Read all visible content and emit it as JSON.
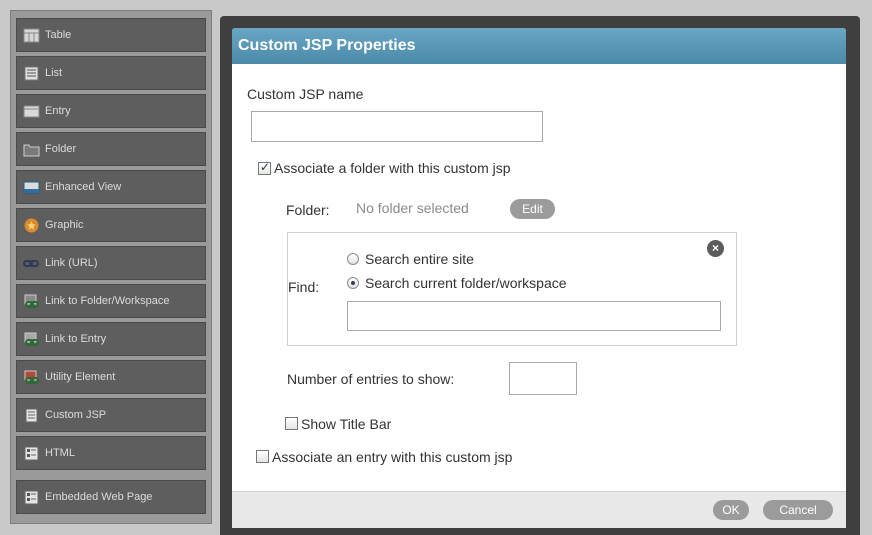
{
  "palette": {
    "items": [
      {
        "label": "Table",
        "icon": "table-icon"
      },
      {
        "label": "List",
        "icon": "list-icon"
      },
      {
        "label": "Entry",
        "icon": "entry-icon"
      },
      {
        "label": "Folder",
        "icon": "folder-icon"
      },
      {
        "label": "Enhanced View",
        "icon": "enhanced-view-icon"
      },
      {
        "label": "Graphic",
        "icon": "graphic-icon"
      },
      {
        "label": "Link (URL)",
        "icon": "link-icon"
      },
      {
        "label": "Link to Folder/Workspace",
        "icon": "link-folder-icon"
      },
      {
        "label": "Link to Entry",
        "icon": "link-entry-icon"
      },
      {
        "label": "Utility Element",
        "icon": "utility-icon"
      },
      {
        "label": "Custom JSP",
        "icon": "custom-jsp-icon"
      },
      {
        "label": "HTML",
        "icon": "html-icon"
      },
      {
        "label": "Embedded Web Page",
        "icon": "embedded-web-page-icon"
      }
    ]
  },
  "dialog": {
    "title": "Custom JSP Properties",
    "jsp_name_label": "Custom JSP name",
    "jsp_name_value": "",
    "associate_folder_label": "Associate a folder with this custom jsp",
    "associate_folder_checked": true,
    "folder_label": "Folder:",
    "folder_value": "No folder selected",
    "edit_label": "Edit",
    "find_label": "Find:",
    "search_entire_site": "Search entire site",
    "search_current_folder": "Search current folder/workspace",
    "search_selected": "current",
    "find_value": "",
    "entries_label": "Number of entries to show:",
    "entries_value": "",
    "show_title_bar_label": "Show Title Bar",
    "show_title_bar_checked": false,
    "associate_entry_label": "Associate an entry with this custom jsp",
    "associate_entry_checked": false,
    "ok_label": "OK",
    "cancel_label": "Cancel"
  },
  "colors": {
    "header_blue": "#5b98b9",
    "palette_tile": "#5e5e5e",
    "frame_dark": "#3f3f3f",
    "footer_gray": "#e8e8e8",
    "button_gray": "#9b9b9b"
  }
}
